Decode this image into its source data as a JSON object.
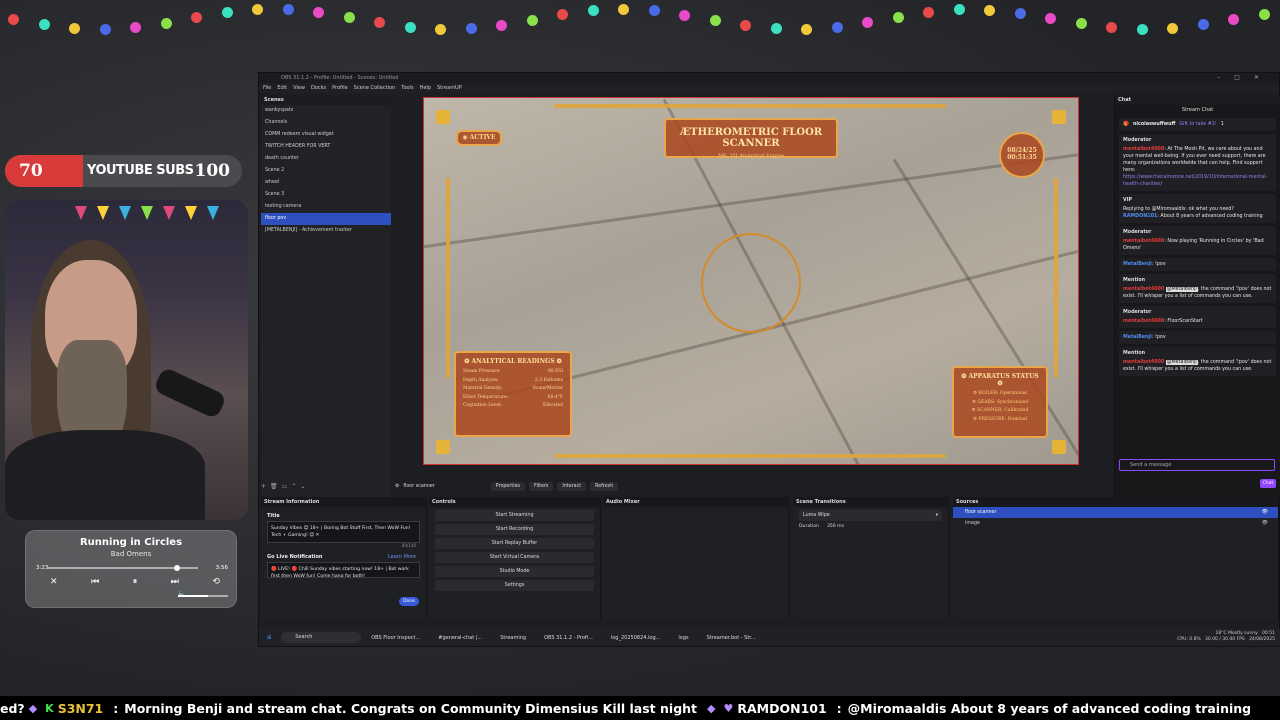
{
  "obs": {
    "title": "OBS 31.1.2 - Profile: Untitled - Scenes: Untitled",
    "menu": [
      "File",
      "Edit",
      "View",
      "Docks",
      "Profile",
      "Scene Collection",
      "Tools",
      "Help",
      "StreamUP"
    ],
    "scenes_title": "Scenes",
    "scenes": [
      "wankyspats",
      "Channels",
      "COMM redeem visual widget",
      "TWITCH HEADER FOR VERT",
      "death counter",
      "Scene 2",
      "wheel",
      "Scene 3",
      "testing camera",
      "floor pov",
      "[METALBENJI] - Achievement tracker"
    ],
    "active_scene": "floor pov"
  },
  "hud": {
    "title": "ÆTHEROMETRIC FLOOR SCANNER",
    "subtitle": "MK. VII Analytical Engine",
    "active": "◉ ACTIVE",
    "date": "08/24/25",
    "time": "00:51:35",
    "analytical_header": "❂ ANALYTICAL READINGS ❂",
    "readings": [
      {
        "label": "Steam Pressure:",
        "value": "88 PSI"
      },
      {
        "label": "Depth Analysis:",
        "value": "2.3 Fathoms"
      },
      {
        "label": "Material Density:",
        "value": "Stone/Mortar"
      },
      {
        "label": "Ether Temperature:",
        "value": "68.4°F"
      },
      {
        "label": "Cogitation Level:",
        "value": "Elevated"
      }
    ],
    "apparatus_header": "❂ APPARATUS STATUS ❂",
    "apparatus": [
      "⚙ BOILER: Operational",
      "⚙ GEARS: Synchronized",
      "⚙ SCANNER: Calibrated",
      "⚙ PRESSURE: Nominal"
    ]
  },
  "toolbar": {
    "source_name": "floor scanner",
    "properties": "Properties",
    "filters": "Filters",
    "interact": "Interact",
    "refresh": "Refresh"
  },
  "stream_info": {
    "title": "Stream Information",
    "title_label": "Title",
    "title_value": "Sunday Vibes 😊 18+ | Boring Bot Stuff First, Then WoW Fun! Tech + Gaming! 😊 ✕",
    "title_count": "80/140",
    "golive_label": "Go Live Notification",
    "learn_more": "Learn More",
    "golive_value": "🔴 LIVE! 🔴 Chill Sunday vibes starting now! 18+ | Bot work first then WoW fun! Come hang for both!",
    "done": "Done"
  },
  "controls": {
    "title": "Controls",
    "buttons": [
      "Start Streaming",
      "Start Recording",
      "Start Replay Buffer",
      "Start Virtual Camera",
      "Studio Mode",
      "Settings"
    ]
  },
  "mixer": {
    "title": "Audio Mixer"
  },
  "transitions": {
    "title": "Scene Transitions",
    "selected": "Luma Wipe",
    "duration_label": "Duration",
    "duration_value": "350 ms"
  },
  "sources": {
    "title": "Sources",
    "items": [
      "floor scanner",
      "image"
    ]
  },
  "chat": {
    "dock_title": "Chat",
    "title": "Stream Chat",
    "gift_user": "nicolaswuffwuff",
    "gift_text": "Gift to take #1!",
    "gift_count": "1",
    "msgs": [
      {
        "role": "Moderator",
        "user": "mentalbot4000",
        "text": ": At The Mosh Pit, we care about you and your mental well-being. If you ever need support, there are many organizations worldwide that can help. Find support here:",
        "link": "https://www.thecalmzone.net/2019/10/international-mental-health-charities/"
      },
      {
        "role": "VIP",
        "reply": "Replying to @Miromaaldis: ok what you need?",
        "user": "RAMDON101",
        "text": ": About 8 years of advanced coding training"
      },
      {
        "role": "Moderator",
        "user": "mentalbot4000",
        "text": ": Now playing 'Running in Circles' by 'Bad Omens'"
      },
      {
        "user": "MetalBenji",
        "text": ": !pov"
      },
      {
        "role": "Mention",
        "user": "mentalbot4000",
        "mention": "@MetalBenji",
        "text": ", the command '!pov' does not exist. I'll whisper you a list of commands you can use."
      },
      {
        "role": "Moderator",
        "user": "mentalbot4000",
        "text": ": FloorScanStart"
      },
      {
        "user": "MetalBenji",
        "text": ": !pov"
      },
      {
        "role": "Mention",
        "user": "mentalbot4000",
        "mention": "@MetalBenji",
        "text": ", the command '!pov' does not exist. I'll whisper you a list of commands you can use."
      }
    ],
    "input_placeholder": "Send a message",
    "send": "Chat"
  },
  "taskbar": {
    "search": "Search",
    "items": [
      "OBS Floor Inspect...",
      "#general-chat |...",
      "Streaming",
      "OBS 31.1.2 - Profi...",
      "log_20250824.log...",
      "logs",
      "Streamer.bot - Str..."
    ],
    "weather": "18°C Mostly sunny",
    "time": "00:51",
    "date": "24/08/2025",
    "cpu": "CPU: 0.8%",
    "fps": "30.00 / 30.00 FPS"
  },
  "subs": {
    "current": "70",
    "label": "YOUTUBE SUBS",
    "goal": "100",
    "fill_fraction": 0.33
  },
  "player": {
    "title": "Running in Circles",
    "artist": "Bad Omens",
    "elapsed": "3:23",
    "total": "3:56",
    "progress": 0.86,
    "volume": 0.6
  },
  "ticker": {
    "lead": "ed?",
    "user1": "S3N71",
    "msg1": "Morning Benji and stream chat. Congrats on Community Dimensius Kill last night",
    "user2": "RAMDON101",
    "msg2": "@Miromaaldis About 8 years of advanced coding training"
  }
}
